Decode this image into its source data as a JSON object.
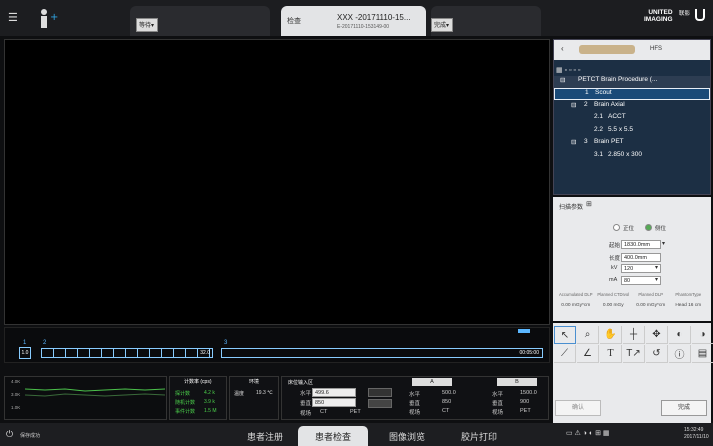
{
  "header": {
    "patient_tab": "等待",
    "exam_tab": "检查",
    "patient_name": "XXX -20171110-15...",
    "exam_id": "E-20171110-153149-00",
    "done_tab": "完成",
    "brand": [
      "UNITED",
      "IMAGING"
    ],
    "brand_cn": "联影"
  },
  "right_panel": {
    "position": "HFS",
    "procedure": "PETCT Brain Procedure (...",
    "items": [
      {
        "num": "1",
        "label": "Scout"
      },
      {
        "num": "2",
        "label": "Brain Axial"
      },
      {
        "num": "2.1",
        "label": "ACCT"
      },
      {
        "num": "2.2",
        "label": "5.5 x 5.5"
      },
      {
        "num": "3",
        "label": "Brain PET"
      },
      {
        "num": "3.1",
        "label": "2.850 x 300"
      }
    ]
  },
  "scan_params": {
    "title": "扫描参数",
    "pos_label": "正位",
    "lat_label": "侧位",
    "start_label": "起始",
    "start_value": "1830.0mm",
    "length_label": "长度",
    "length_value": "400.0mm",
    "kv_label": "kV",
    "kv_value": "120",
    "ma_label": "mA",
    "ma_value": "80",
    "dose_headers": [
      "Accumulated DLP",
      "Planned CTDIvol",
      "Planned DLP",
      "PhantomType"
    ],
    "dose_values": [
      "0.00 mGy*cm",
      "0.00 mGy",
      "0.00 mGy*cm",
      "Head 16 cm"
    ]
  },
  "actions": {
    "confirm": "确认",
    "finish": "完成"
  },
  "timeline": {
    "marks": [
      "1",
      "2",
      "3"
    ],
    "value": "1.0",
    "end": "32.0",
    "duration": "00:05:00"
  },
  "counts": {
    "title": "计数率 (cps)",
    "rows": [
      {
        "label": "探计数",
        "value": "4.2 k"
      },
      {
        "label": "随机计数",
        "value": "3.9 k"
      },
      {
        "label": "事件计数",
        "value": "1.5 M"
      }
    ],
    "ylabels": [
      "4.0K",
      "3.0K",
      "1.0K"
    ]
  },
  "env": {
    "title": "环境",
    "temp_label": "温度",
    "temp_value": "19.3 ℃"
  },
  "bed": {
    "title": "床位输入区",
    "h_label": "水平",
    "h_value": "499.6",
    "v_label": "垂直",
    "v_value": "850",
    "view_label": "视场",
    "ct": "CT",
    "pet": "PET",
    "a": "A",
    "a_h": "500.0",
    "a_v": "850",
    "a_view": "CT",
    "b": "B",
    "b_h": "1500.0",
    "b_v": "900",
    "b_view": "PET"
  },
  "status": {
    "text": "保存成功",
    "time": "15:32:49",
    "date": "2017/11/10"
  },
  "nav": [
    "患者注册",
    "患者检查",
    "图像浏览",
    "胶片打印"
  ]
}
